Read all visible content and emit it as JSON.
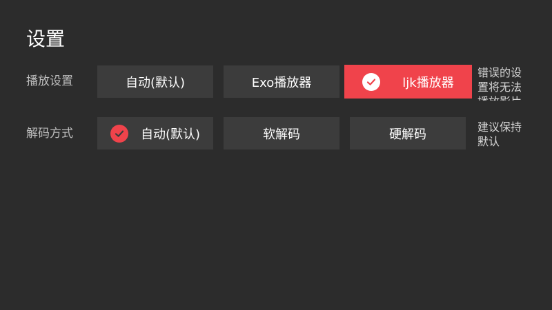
{
  "title": "设置",
  "rows": [
    {
      "label": "播放设置",
      "options": [
        "自动(默认)",
        "Exo播放器",
        "ljk播放器"
      ],
      "hint": "错误的设置将无法播放影片"
    },
    {
      "label": "解码方式",
      "options": [
        "自动(默认)",
        "软解码",
        "硬解码"
      ],
      "hint": "建议保持默认"
    }
  ],
  "icons": {
    "selected": "check-circle-icon"
  },
  "colors": {
    "background": "#2c2c2c",
    "button": "#3c3c3c",
    "accent": "#f0434b",
    "label": "#bdbdbd"
  }
}
